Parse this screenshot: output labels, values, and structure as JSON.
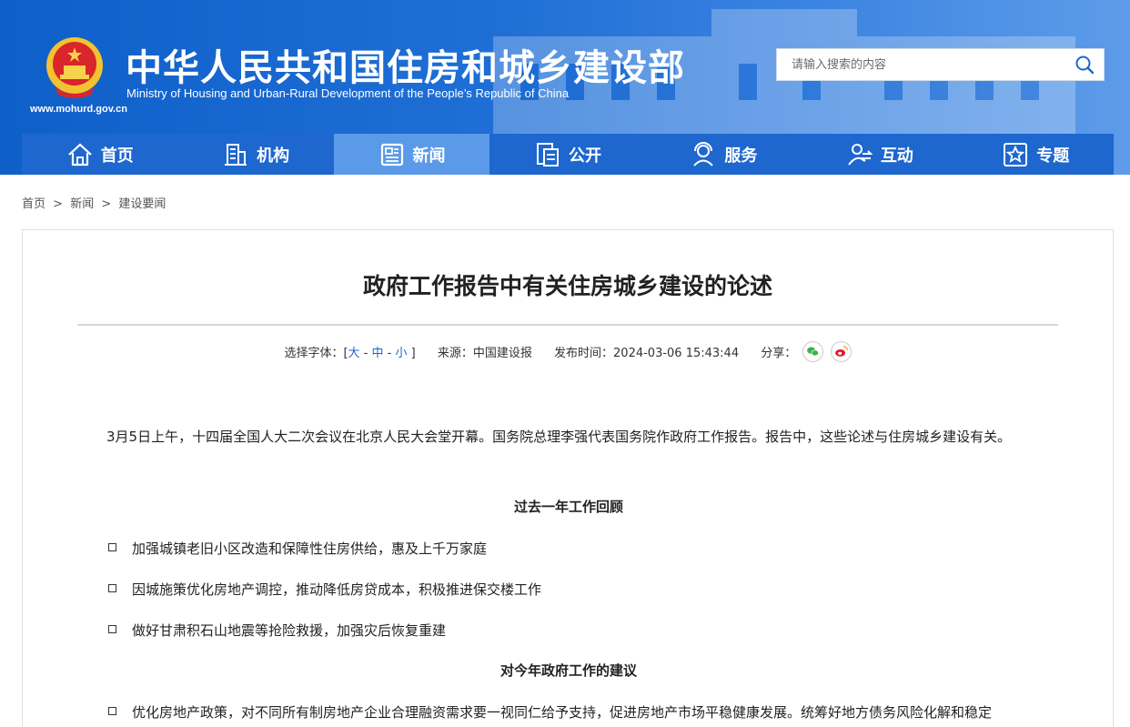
{
  "header": {
    "title_cn": "中华人民共和国住房和城乡建设部",
    "title_en": "Ministry of Housing and Urban-Rural Development of the People’s Republic of China",
    "url": "www.mohurd.gov.cn"
  },
  "search": {
    "placeholder": "请输入搜索的内容",
    "icon": "search-icon"
  },
  "nav": {
    "items": [
      {
        "label": "首页",
        "icon": "home-icon"
      },
      {
        "label": "机构",
        "icon": "building-icon"
      },
      {
        "label": "新闻",
        "icon": "news-icon",
        "active": true
      },
      {
        "label": "公开",
        "icon": "documents-icon"
      },
      {
        "label": "服务",
        "icon": "service-icon"
      },
      {
        "label": "互动",
        "icon": "interaction-icon"
      },
      {
        "label": "专题",
        "icon": "star-icon"
      }
    ]
  },
  "breadcrumb": {
    "items": [
      "首页",
      "新闻",
      "建设要闻"
    ],
    "separator": ">"
  },
  "article": {
    "title": "政府工作报告中有关住房城乡建设的论述",
    "meta": {
      "font_label": "选择字体：[",
      "font_large": "大",
      "font_medium": "中",
      "font_small": "小",
      "font_close": "]",
      "source": "来源：中国建设报",
      "published": "发布时间：2024-03-06 15:43:44",
      "share_label": "分享："
    },
    "intro": "3月5日上午，十四届全国人大二次会议在北京人民大会堂开幕。国务院总理李强代表国务院作政府工作报告。报告中，这些论述与住房城乡建设有关。",
    "section1_heading": "过去一年工作回顾",
    "section1_items": [
      "加强城镇老旧小区改造和保障性住房供给，惠及上千万家庭",
      "因城施策优化房地产调控，推动降低房贷成本，积极推进保交楼工作",
      "做好甘肃积石山地震等抢险救援，加强灾后恢复重建"
    ],
    "section2_heading": "对今年政府工作的建议",
    "section2_items": [
      "优化房地产政策，对不同所有制房地产企业合理融资需求要一视同仁给予支持，促进房地产市场平稳健康发展。统筹好地方债务风险化解和稳定"
    ]
  },
  "colors": {
    "brand_blue": "#1d67cf",
    "nav_active": "#5a9ae8",
    "wechat_green": "#3bb24a",
    "weibo_red": "#e6162d"
  }
}
